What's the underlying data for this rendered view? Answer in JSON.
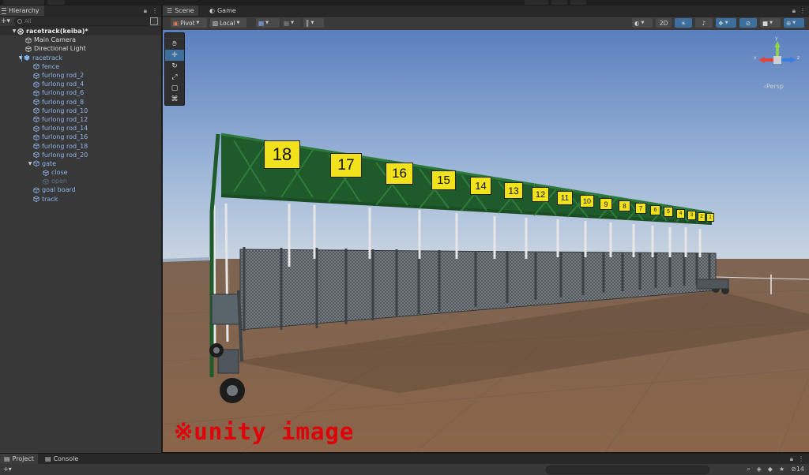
{
  "hierarchy": {
    "tab_label": "Hierarchy",
    "search_placeholder": "All",
    "items": [
      {
        "label": "racetrack(keiba)*"
      },
      {
        "label": "Main Camera"
      },
      {
        "label": "Directional Light"
      },
      {
        "label": "racetrack"
      },
      {
        "label": "fence"
      },
      {
        "label": "furlong rod_2"
      },
      {
        "label": "furlong rod_4"
      },
      {
        "label": "furlong rod_6"
      },
      {
        "label": "furlong rod_8"
      },
      {
        "label": "furlong rod_10"
      },
      {
        "label": "furlong rod_12"
      },
      {
        "label": "furlong rod_14"
      },
      {
        "label": "furlong rod_16"
      },
      {
        "label": "furlong rod_18"
      },
      {
        "label": "furlong rod_20"
      },
      {
        "label": "gate"
      },
      {
        "label": "close"
      },
      {
        "label": "open"
      },
      {
        "label": "goal board"
      },
      {
        "label": "track"
      }
    ]
  },
  "scene": {
    "tabs": [
      "Scene",
      "Game"
    ],
    "pivot_label": "Pivot",
    "local_label": "Local",
    "mode_2d_label": "2D",
    "persp_label": "‹Persp",
    "axis_labels": {
      "y": "y",
      "x": "x",
      "z": "z"
    },
    "gate_numbers": [
      "18",
      "17",
      "16",
      "15",
      "14",
      "13",
      "12",
      "11",
      "10",
      "9",
      "8",
      "7",
      "6",
      "5",
      "4",
      "3",
      "2",
      "1"
    ],
    "watermark": "※unity image"
  },
  "bottom": {
    "tabs": [
      "Project",
      "Console"
    ],
    "hidden_count": "14"
  },
  "colors": {
    "accent_blue": "#3d6f9e",
    "prefab_text": "#8fb4ea",
    "sky_top": "#5a7fbe",
    "ground": "#8a6a52",
    "gate_green": "#1f5a2b",
    "number_yellow": "#f2e21c",
    "watermark_red": "#e0000a"
  }
}
